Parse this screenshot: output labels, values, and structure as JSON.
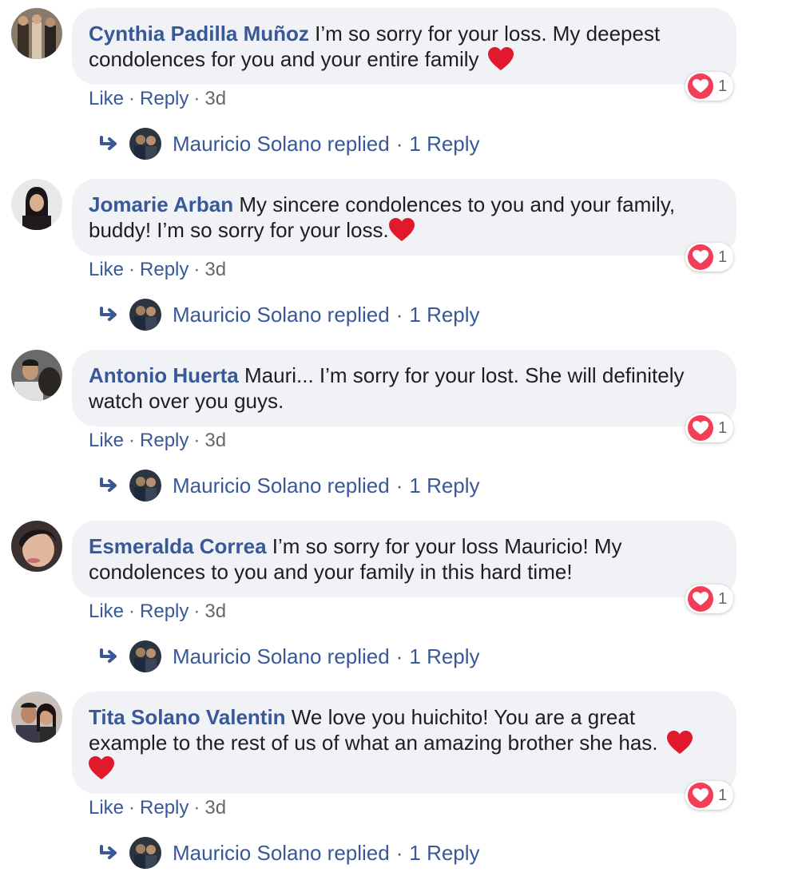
{
  "colors": {
    "link": "#385898",
    "bubble": "#f0f2f5",
    "love": "#f33e58",
    "muted": "#65676b"
  },
  "comments": [
    {
      "author": "Cynthia Padilla Muñoz",
      "text": "I’m so sorry for your loss. My deepest condolences for you and your entire family",
      "trailing_emoji": "red-heart",
      "reaction_count": "1",
      "like": "Like",
      "reply": "Reply",
      "time": "3d",
      "replied_by": "Mauricio Solano replied",
      "reply_count": "1 Reply"
    },
    {
      "author": "Jomarie Arban",
      "text": "My sincere condolences to you and your family, buddy! I’m so sorry for your loss.",
      "trailing_emoji": "red-heart",
      "reaction_count": "1",
      "like": "Like",
      "reply": "Reply",
      "time": "3d",
      "replied_by": "Mauricio Solano replied",
      "reply_count": "1 Reply"
    },
    {
      "author": "Antonio Huerta",
      "text": "Mauri... I’m sorry for your lost. She will definitely watch over you guys.",
      "trailing_emoji": "",
      "reaction_count": "1",
      "like": "Like",
      "reply": "Reply",
      "time": "3d",
      "replied_by": "Mauricio Solano replied",
      "reply_count": "1 Reply"
    },
    {
      "author": "Esmeralda Correa",
      "text": "I’m so sorry for your loss Mauricio! My condolences to you and your family in this hard time!",
      "trailing_emoji": "",
      "reaction_count": "1",
      "like": "Like",
      "reply": "Reply",
      "time": "3d",
      "replied_by": "Mauricio Solano replied",
      "reply_count": "1 Reply"
    },
    {
      "author": "Tita Solano Valentin",
      "text": "We love you huichito! You are a great example to the rest of us of what an amazing brother she has.",
      "trailing_emoji": "red-heart x2",
      "reaction_count": "1",
      "like": "Like",
      "reply": "Reply",
      "time": "3d",
      "replied_by": "Mauricio Solano replied",
      "reply_count": "1 Reply"
    }
  ]
}
